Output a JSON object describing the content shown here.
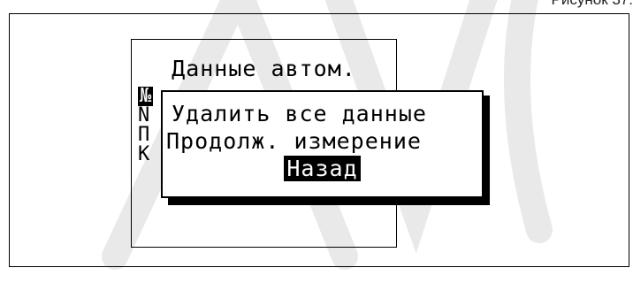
{
  "caption": "Рисунок 37.",
  "screen": {
    "title": "Данные автом.",
    "background_items": [
      {
        "label": "№",
        "selected": true
      },
      {
        "label": "N",
        "selected": false
      },
      {
        "label": "П",
        "selected": false
      },
      {
        "label": "К",
        "selected": false
      }
    ]
  },
  "popup": {
    "items": [
      {
        "label": "Удалить все данные",
        "selected": false
      },
      {
        "label": "Продолж. измерение",
        "selected": false
      },
      {
        "label": "Назад",
        "selected": true
      }
    ]
  },
  "colors": {
    "background": "#ffffff",
    "foreground": "#000000",
    "watermark": "#e9e9e9"
  }
}
